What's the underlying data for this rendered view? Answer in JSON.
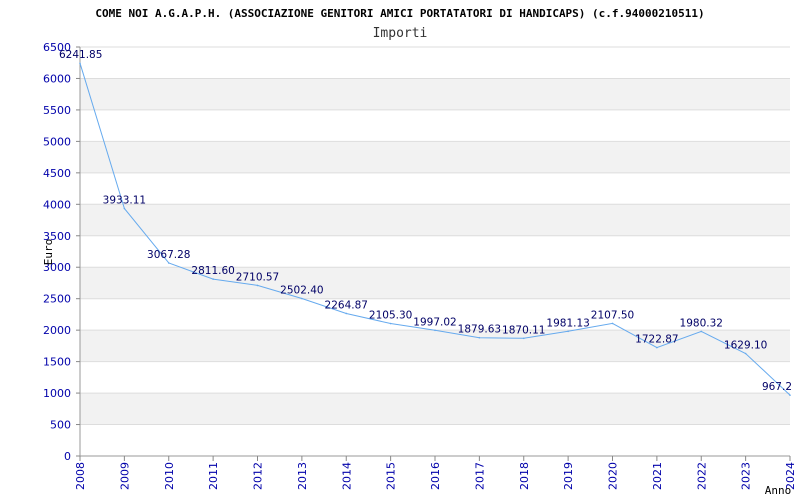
{
  "chart_data": {
    "type": "line",
    "title": "COME NOI A.G.A.P.H. (ASSOCIAZIONE GENITORI AMICI PORTATATORI DI HANDICAPS) (c.f.94000210511)",
    "subtitle": "Importi",
    "xlabel": "Anno",
    "ylabel": "Euro",
    "ylim": [
      0,
      6500
    ],
    "yticks": [
      0,
      500,
      1000,
      1500,
      2000,
      2500,
      3000,
      3500,
      4000,
      4500,
      5000,
      5500,
      6000,
      6500
    ],
    "x": [
      "2008",
      "2009",
      "2010",
      "2011",
      "2012",
      "2013",
      "2014",
      "2015",
      "2016",
      "2017",
      "2018",
      "2019",
      "2020",
      "2021",
      "2022",
      "2023",
      "2024"
    ],
    "values": [
      6241.85,
      3933.11,
      3067.28,
      2811.6,
      2710.57,
      2502.4,
      2264.87,
      2105.3,
      1997.02,
      1879.63,
      1870.11,
      1981.13,
      2107.5,
      1722.87,
      1980.32,
      1629.1,
      967.2
    ],
    "labels": [
      "6241.85",
      "3933.11",
      "3067.28",
      "2811.60",
      "2710.57",
      "2502.40",
      "2264.87",
      "2105.30",
      "1997.02",
      "1879.63",
      "1870.11",
      "1981.13",
      "2107.50",
      "1722.87",
      "1980.32",
      "1629.10",
      "967.2"
    ],
    "grid": true,
    "colors": {
      "line": "#66aaee",
      "band": "#f2f2f2",
      "tick_text": "#0000aa",
      "label_text": "#000066"
    }
  }
}
